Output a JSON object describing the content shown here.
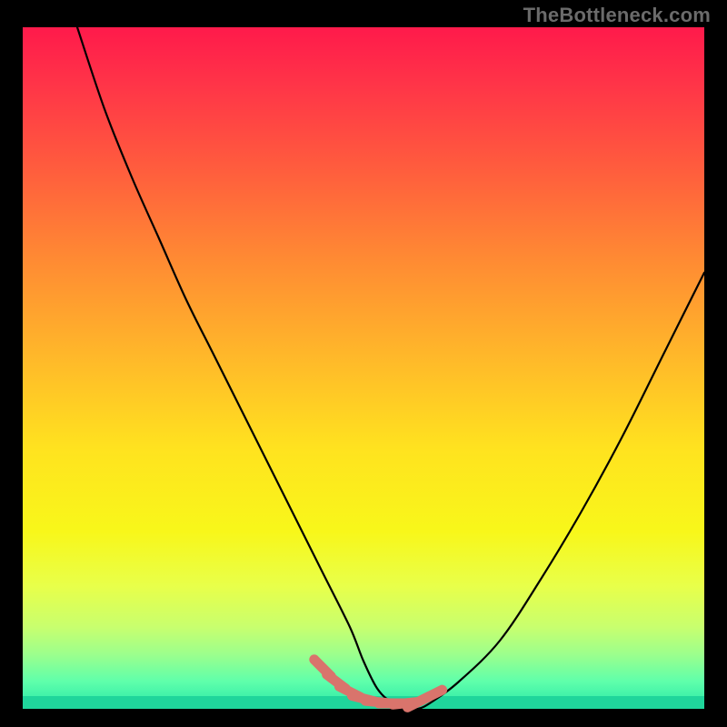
{
  "watermark": "TheBottleneck.com",
  "colors": {
    "page_bg": "#000000",
    "curve_stroke": "#000000",
    "marker_stroke": "#d9746c",
    "gradient_top": "#ff1a4b",
    "gradient_bottom": "#1fd59b"
  },
  "chart_data": {
    "type": "line",
    "title": "",
    "xlabel": "",
    "ylabel": "",
    "xlim": [
      0,
      100
    ],
    "ylim": [
      0,
      100
    ],
    "grid": false,
    "legend": false,
    "series": [
      {
        "name": "bottleneck-curve",
        "x": [
          8,
          12,
          16,
          20,
          24,
          28,
          32,
          36,
          40,
          44,
          48,
          50,
          52,
          54,
          56,
          58,
          60,
          64,
          70,
          76,
          82,
          88,
          94,
          100
        ],
        "y": [
          100,
          88,
          78,
          69,
          60,
          52,
          44,
          36,
          28,
          20,
          12,
          7,
          3,
          1,
          0,
          0,
          1,
          4,
          10,
          19,
          29,
          40,
          52,
          64
        ]
      }
    ],
    "markers": {
      "name": "highlight-segment",
      "x": [
        44,
        46,
        48,
        50,
        52,
        54,
        56,
        58,
        60
      ],
      "y": [
        6,
        4,
        2.5,
        1.5,
        1,
        0.8,
        0.8,
        1,
        2
      ]
    }
  }
}
